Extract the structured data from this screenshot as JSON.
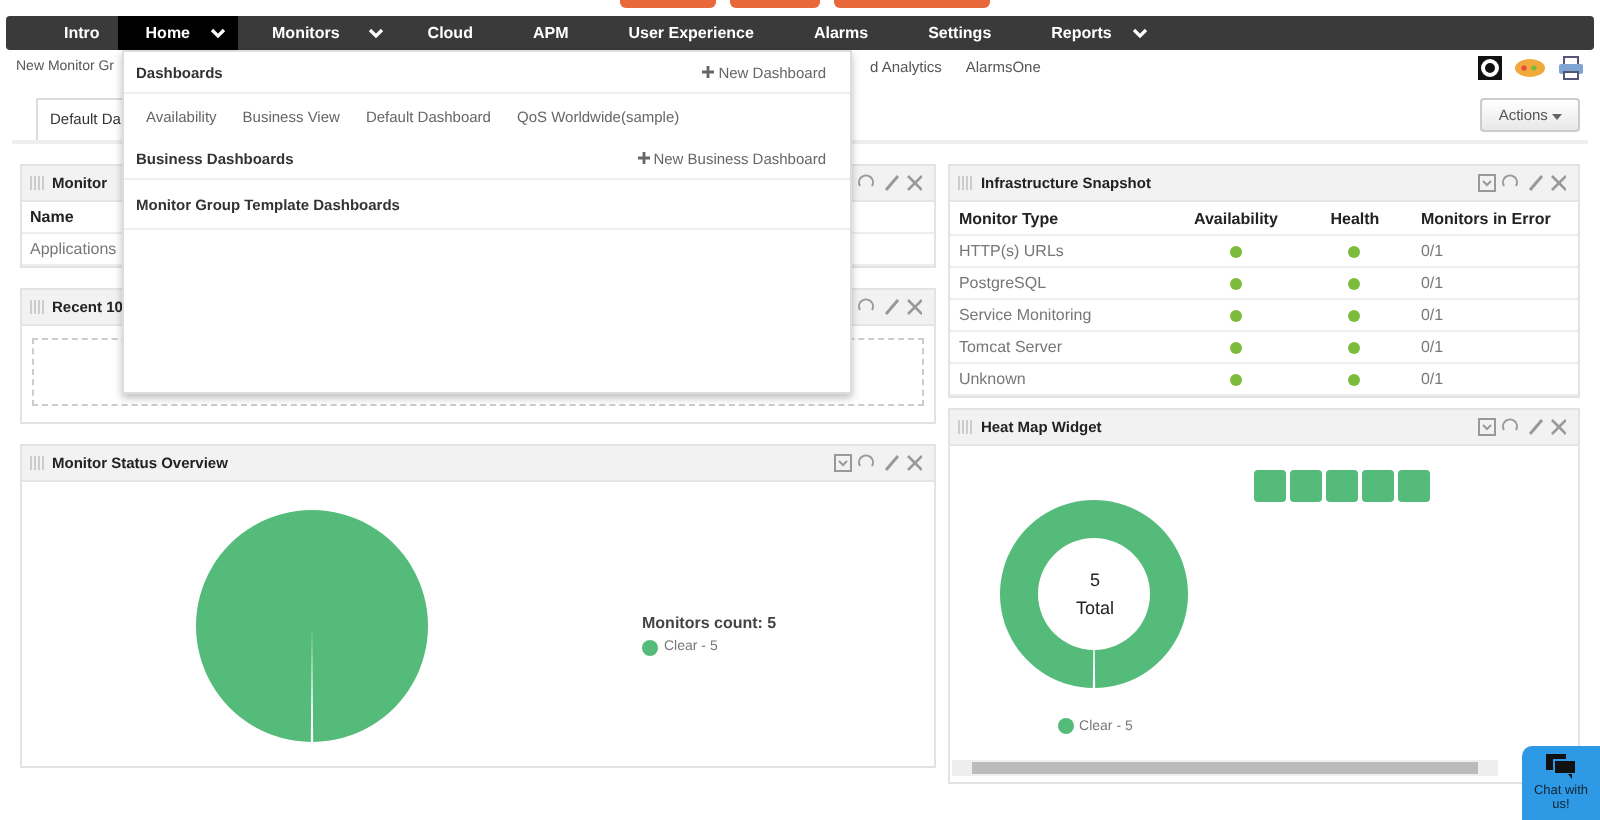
{
  "nav": [
    {
      "label": "Intro",
      "selected": false,
      "caret": false
    },
    {
      "label": "Home",
      "selected": true,
      "caret": true
    },
    {
      "label": "Monitors",
      "selected": false,
      "caret": true
    },
    {
      "label": "Cloud",
      "selected": false,
      "caret": false
    },
    {
      "label": "APM",
      "selected": false,
      "caret": false
    },
    {
      "label": "User Experience",
      "selected": false,
      "caret": false
    },
    {
      "label": "Alarms",
      "selected": false,
      "caret": false
    },
    {
      "label": "Settings",
      "selected": false,
      "caret": false
    },
    {
      "label": "Reports",
      "selected": false,
      "caret": true
    }
  ],
  "subnav": [
    "New Monitor Gr",
    "d Analytics",
    "AlarmsOne"
  ],
  "tab": {
    "label": "Default Da",
    "selected": true
  },
  "actions_button": "Actions",
  "dropdown": {
    "dashboards_heading": "Dashboards",
    "new_dashboard": "New Dashboard",
    "dashboards": [
      "Availability",
      "Business View",
      "Default Dashboard",
      "QoS Worldwide(sample)"
    ],
    "business_heading": "Business Dashboards",
    "new_business_dashboard": "New Business Dashboard",
    "template_heading": "Monitor Group Template Dashboards"
  },
  "monitor_groups": {
    "title": "Monitor",
    "column": "Name",
    "row": "Applications"
  },
  "recent": {
    "title": "Recent 10"
  },
  "status_overview": {
    "title": "Monitor Status Overview",
    "count_label": "Monitors count: 5",
    "legend": "Clear - 5"
  },
  "snapshot": {
    "title": "Infrastructure Snapshot",
    "columns": [
      "Monitor Type",
      "Availability",
      "Health",
      "Monitors in Error"
    ],
    "rows": [
      {
        "type": "HTTP(s) URLs",
        "available": true,
        "healthy": true,
        "errors": "0/1"
      },
      {
        "type": "PostgreSQL",
        "available": true,
        "healthy": true,
        "errors": "0/1"
      },
      {
        "type": "Service Monitoring",
        "available": true,
        "healthy": true,
        "errors": "0/1"
      },
      {
        "type": "Tomcat Server",
        "available": true,
        "healthy": true,
        "errors": "0/1"
      },
      {
        "type": "Unknown",
        "available": true,
        "healthy": true,
        "errors": "0/1"
      }
    ]
  },
  "heatmap": {
    "title": "Heat Map Widget",
    "total": "5",
    "total_label": "Total",
    "legend": "Clear - 5",
    "cells": [
      {
        "color": "#55bb7a"
      },
      {
        "color": "#55bb7a"
      },
      {
        "color": "#55bb7a"
      },
      {
        "color": "#55bb7a"
      },
      {
        "color": "#55bb7a"
      }
    ]
  },
  "chat": "Chat with us!"
}
